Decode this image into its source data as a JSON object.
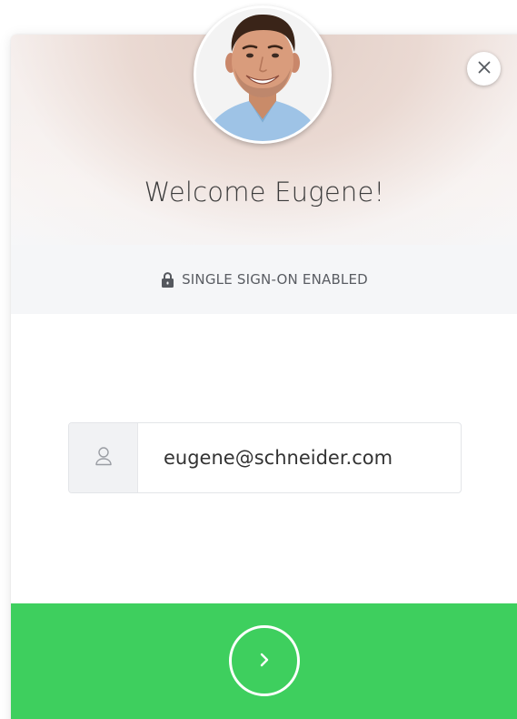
{
  "header": {
    "welcome_text": "Welcome Eugene!",
    "avatar_icon": "user-photo"
  },
  "sso": {
    "label": "SINGLE SIGN-ON ENABLED",
    "icon": "lock-icon"
  },
  "login": {
    "email_value": "eugene@schneider.com",
    "field_icon": "user-icon"
  },
  "submit": {
    "icon": "chevron-right-icon"
  },
  "close": {
    "icon": "close-icon"
  },
  "colors": {
    "accent_green": "#3ecf5e",
    "sso_bar": "#f5f6f8",
    "text_dark": "#3b3b3b"
  }
}
